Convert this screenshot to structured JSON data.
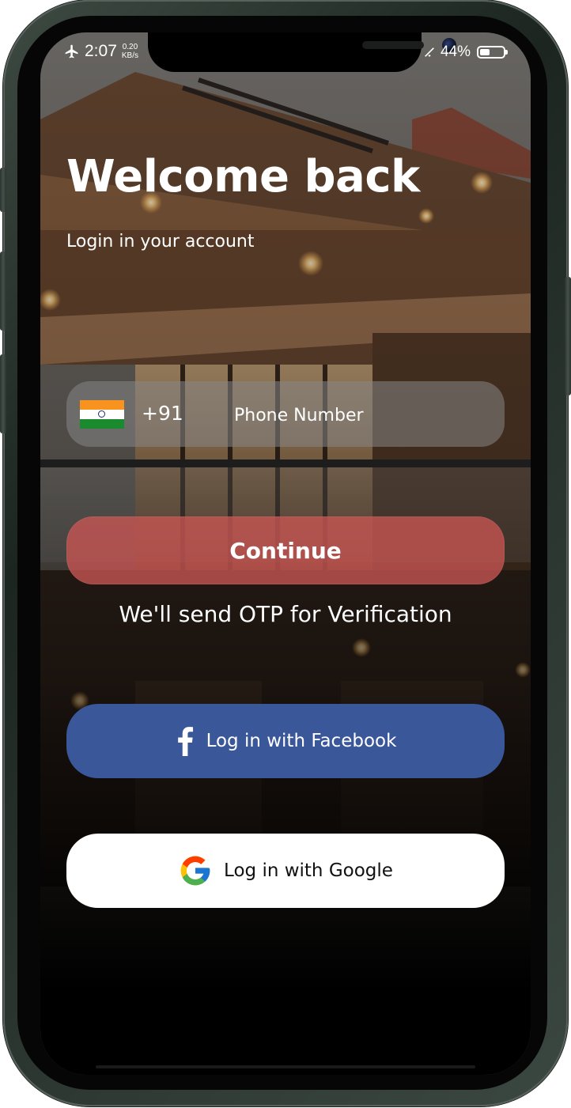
{
  "status_bar": {
    "time": "2:07",
    "net_speed_value": "0.20",
    "net_speed_unit": "KB/s",
    "battery_percent": "44%",
    "battery_level": 0.44,
    "icons": [
      "airplane-icon",
      "wifi-icon",
      "battery-icon"
    ]
  },
  "login": {
    "title": "Welcome back",
    "subtitle": "Login in your account",
    "country_code": "+91",
    "phone_placeholder": "Phone Number",
    "phone_value": "",
    "continue_label": "Continue",
    "otp_note": "We'll send OTP for Verification"
  },
  "social": {
    "facebook_label": "Log in with Facebook",
    "google_label": "Log in with Google"
  },
  "colors": {
    "continue_bg": "#c95653",
    "facebook_bg": "#3a579a",
    "google_bg": "#ffffff",
    "frame": "#2a342e"
  }
}
